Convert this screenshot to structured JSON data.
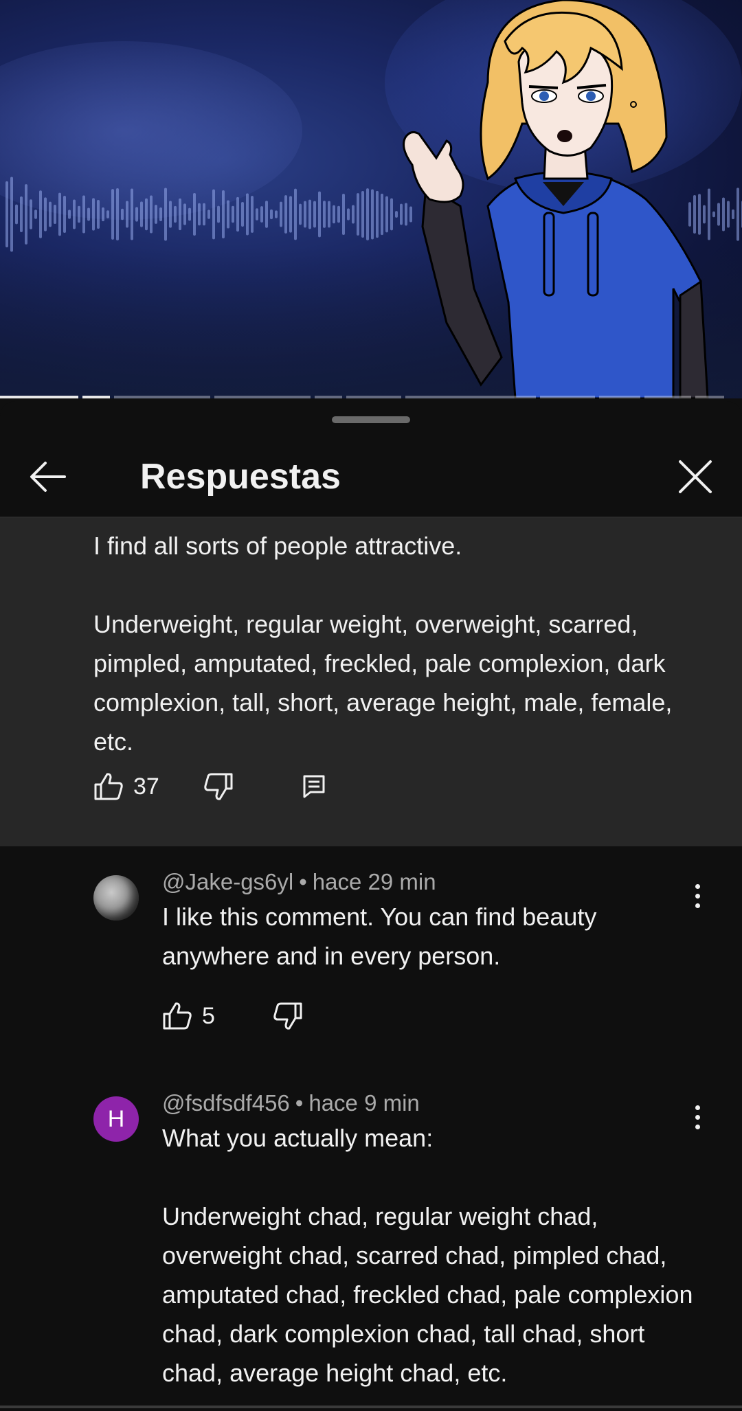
{
  "header": {
    "title": "Respuestas"
  },
  "parent_comment": {
    "text": "I find all sorts of people attractive.\n\nUnderweight, regular weight, overweight, scarred, pimpled, amputated, freckled, pale complexion, dark complexion, tall, short, average height, male, female, etc.",
    "likes": "37"
  },
  "replies": [
    {
      "handle": "@Jake-gs6yl",
      "separator": "•",
      "time": "hace 29 min",
      "text": "I like this comment. You can find beauty anywhere and in every person.",
      "likes": "5",
      "avatar": "moon"
    },
    {
      "handle": "@fsdfsdf456",
      "separator": "•",
      "time": "hace 9 min",
      "text": "What you actually mean:\n\nUnderweight chad, regular weight chad, overweight chad, scarred chad, pimpled chad, amputated chad, freckled chad, pale complexion chad, dark complexion chad, tall chad, short chad, average height chad, etc.",
      "avatar_letter": "H",
      "avatar_color": "#8e24aa"
    }
  ],
  "icons": {
    "back": "arrow-left-icon",
    "close": "close-icon",
    "like": "thumbs-up-icon",
    "dislike": "thumbs-down-icon",
    "reply": "comment-icon",
    "more": "more-vert-icon"
  }
}
